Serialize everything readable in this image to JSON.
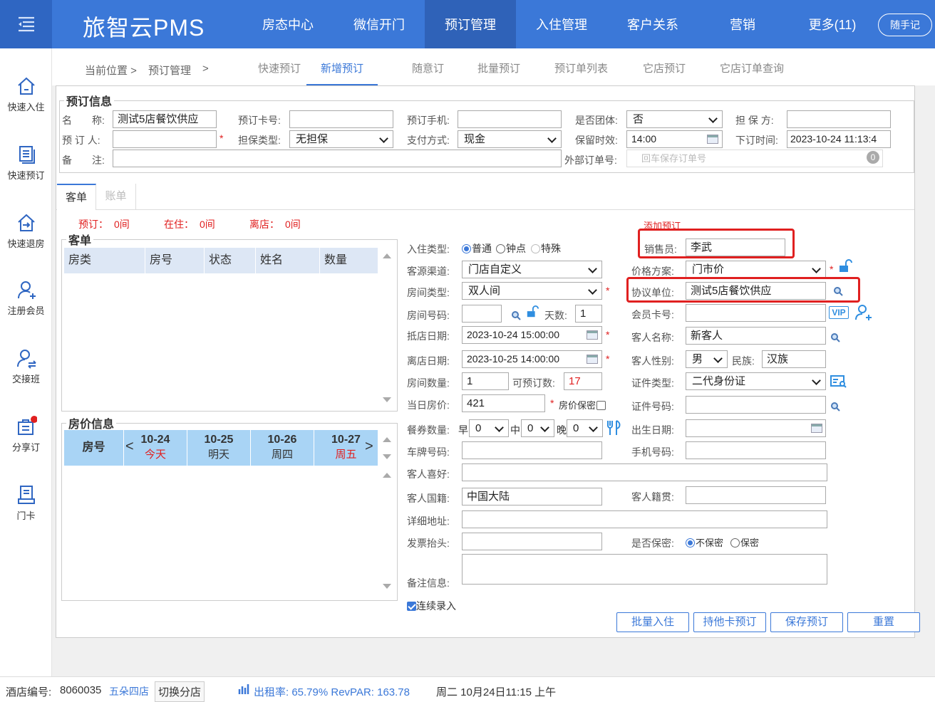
{
  "app": {
    "title": "旅智云PMS",
    "shouji": "随手记"
  },
  "nav": [
    "房态中心",
    "微信开门",
    "预订管理",
    "入住管理",
    "客户关系",
    "营销",
    "更多(11)"
  ],
  "sidebar": [
    "快速入住",
    "快速预订",
    "快速退房",
    "注册会员",
    "交接班",
    "分享订",
    "门卡"
  ],
  "breadcrumb": {
    "prefix": "当前位置 >",
    "item": "预订管理",
    "sep": ">"
  },
  "subtabs": [
    "快速预订",
    "新增预订",
    "随意订",
    "批量预订",
    "预订单列表",
    "它店预订",
    "它店订单查询"
  ],
  "booking": {
    "legend": "预订信息",
    "name_label": "名　　称:",
    "name_value": "测试5店餐饮供应",
    "card_label": "预订卡号:",
    "card_value": "",
    "phone_label": "预订手机:",
    "phone_value": "",
    "group_label": "是否团体:",
    "group_value": "否",
    "guarantor_label": "担 保 方:",
    "guarantor_value": "",
    "booker_label": "预 订 人:",
    "booker_value": "",
    "gtype_label": "担保类型:",
    "gtype_value": "无担保",
    "pay_label": "支付方式:",
    "pay_value": "现金",
    "hold_label": "保留时效:",
    "hold_value": "14:00",
    "ordertime_label": "下订时间:",
    "ordertime_value": "2023-10-24 11:13:4",
    "remark_label": "备　　注:",
    "remark_value": "",
    "ext_label": "外部订单号:",
    "ext_placeholder": "回车保存订单号",
    "ext_badge": "0"
  },
  "tabs": [
    "客单",
    "账单"
  ],
  "summary": {
    "reserve_label": "预订：",
    "reserve_value": "0间",
    "stay_label": "在住：",
    "stay_value": "0间",
    "leave_label": "离店：",
    "leave_value": "0间",
    "add_link": "添加预订"
  },
  "guestlist": {
    "legend": "客单",
    "headers": [
      "房类",
      "房号",
      "状态",
      "姓名",
      "数量"
    ]
  },
  "price": {
    "legend": "房价信息",
    "room_header": "房号",
    "days": [
      {
        "date": "10-24",
        "week": "今天",
        "red": true
      },
      {
        "date": "10-25",
        "week": "明天",
        "red": false
      },
      {
        "date": "10-26",
        "week": "周四",
        "red": false
      },
      {
        "date": "10-27",
        "week": "周五",
        "red": true
      }
    ]
  },
  "form": {
    "checkin_type_label": "入住类型:",
    "checkin_types": [
      "普通",
      "钟点",
      "特殊"
    ],
    "sales_label": "销售员:",
    "sales_value": "李武",
    "source_label": "客源渠道:",
    "source_value": "门店自定义",
    "rate_label": "价格方案:",
    "rate_value": "门市价",
    "roomtype_label": "房间类型:",
    "roomtype_value": "双人间",
    "agreement_label": "协议单位:",
    "agreement_value": "测试5店餐饮供应",
    "roomno_label": "房间号码:",
    "roomno_value": "",
    "days_label": "天数:",
    "days_value": "1",
    "member_label": "会员卡号:",
    "member_value": "",
    "vip": "VIP",
    "arrive_label": "抵店日期:",
    "arrive_value": "2023-10-24 15:00:00",
    "guestname_label": "客人名称:",
    "guestname_value": "新客人",
    "leave_label": "离店日期:",
    "leave_value": "2023-10-25 14:00:00",
    "gender_label": "客人性别:",
    "gender_value": "男",
    "nation_label": "民族:",
    "nation_value": "汉族",
    "roomcount_label": "房间数量:",
    "roomcount_value": "1",
    "avail_label": "可预订数:",
    "avail_value": "17",
    "idtype_label": "证件类型:",
    "idtype_value": "二代身份证",
    "dayprice_label": "当日房价:",
    "dayprice_value": "421",
    "pricesecret_label": "房价保密",
    "idno_label": "证件号码:",
    "idno_value": "",
    "meal_label": "餐券数量:",
    "meal_b": "早",
    "meal_l": "中",
    "meal_d": "晚",
    "meal_b_value": "0",
    "meal_l_value": "0",
    "meal_d_value": "0",
    "birth_label": "出生日期:",
    "birth_value": "",
    "plate_label": "车牌号码:",
    "plate_value": "",
    "mobile_label": "手机号码:",
    "mobile_value": "",
    "hobby_label": "客人喜好:",
    "hobby_value": "",
    "nationality_label": "客人国籍:",
    "nationality_value": "中国大陆",
    "origin_label": "客人籍贯:",
    "origin_value": "",
    "address_label": "详细地址:",
    "address_value": "",
    "invoice_label": "发票抬头:",
    "invoice_value": "",
    "secret_label": "是否保密:",
    "secret_options": [
      "不保密",
      "保密"
    ],
    "note_label": "备注信息:",
    "note_value": "",
    "continuous_label": "连续录入"
  },
  "buttons": [
    "批量入住",
    "持他卡预订",
    "保存预订",
    "重置"
  ],
  "status": {
    "hotel_label": "酒店编号:",
    "hotel_no": "8060035",
    "hotel_name": "五朵四店",
    "switch": "切换分店",
    "occupancy": "出租率: 65.79% RevPAR: 163.78",
    "datetime": "周二 10月24日11:15 上午"
  },
  "colors": {
    "primary": "#3b78d8",
    "nav_active": "#2f62b8",
    "highlight": "#e02020",
    "table_header": "#dde7f5",
    "price_header": "#a9d4f5"
  }
}
